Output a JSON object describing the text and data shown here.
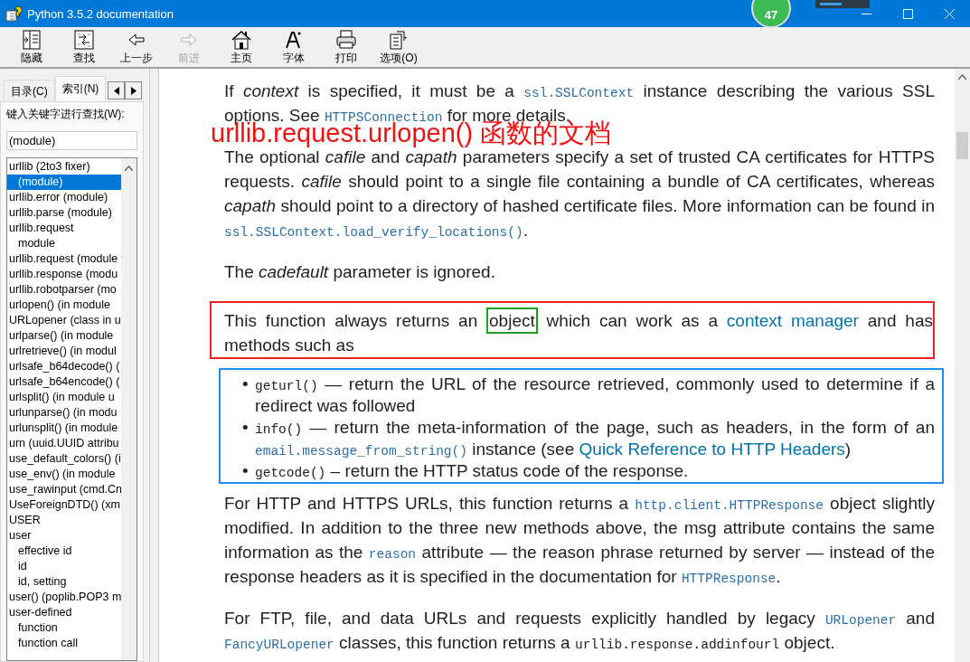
{
  "window": {
    "title": "Python 3.5.2 documentation"
  },
  "overlay": {
    "badge": "47"
  },
  "toolbar": [
    {
      "label": "隐藏",
      "disabled": false
    },
    {
      "label": "查找",
      "disabled": false
    },
    {
      "label": "上一步",
      "disabled": false
    },
    {
      "label": "前进",
      "disabled": true
    },
    {
      "label": "主页",
      "disabled": false
    },
    {
      "label": "字体",
      "disabled": false
    },
    {
      "label": "打印",
      "disabled": false
    },
    {
      "label": "选项(O)",
      "disabled": false
    }
  ],
  "sidebar": {
    "tabs": [
      {
        "label": "目录(C)",
        "selected": false
      },
      {
        "label": "索引(N)",
        "selected": true
      }
    ],
    "search_label": "键入关键字进行查找(W):",
    "search_value": "(module)",
    "items": [
      {
        "label": "urllib (2to3 fixer)",
        "selected": false,
        "children": [
          {
            "label": "(module)",
            "selected": true
          }
        ]
      },
      {
        "label": "urllib.error (module)",
        "selected": false
      },
      {
        "label": "urllib.parse (module)",
        "selected": false
      },
      {
        "label": "urllib.request",
        "selected": false,
        "children": [
          {
            "label": "module",
            "selected": false
          }
        ]
      },
      {
        "label": "urllib.request (module",
        "selected": false
      },
      {
        "label": "urllib.response (modu",
        "selected": false
      },
      {
        "label": "urllib.robotparser (mo",
        "selected": false
      },
      {
        "label": "urlopen() (in module",
        "selected": false
      },
      {
        "label": "URLopener (class in u",
        "selected": false
      },
      {
        "label": "urlparse() (in module",
        "selected": false
      },
      {
        "label": "urlretrieve() (in modul",
        "selected": false
      },
      {
        "label": "urlsafe_b64decode() (",
        "selected": false
      },
      {
        "label": "urlsafe_b64encode() (",
        "selected": false
      },
      {
        "label": "urlsplit() (in module u",
        "selected": false
      },
      {
        "label": "urlunparse() (in modu",
        "selected": false
      },
      {
        "label": "urlunsplit() (in module",
        "selected": false
      },
      {
        "label": "urn (uuid.UUID attribu",
        "selected": false
      },
      {
        "label": "use_default_colors() (i",
        "selected": false
      },
      {
        "label": "use_env() (in module",
        "selected": false
      },
      {
        "label": "use_rawinput (cmd.Cn",
        "selected": false
      },
      {
        "label": "UseForeignDTD() (xm",
        "selected": false
      },
      {
        "label": "USER",
        "selected": false
      },
      {
        "label": "user",
        "selected": false,
        "children": [
          {
            "label": "effective id",
            "selected": false
          },
          {
            "label": "id",
            "selected": false
          },
          {
            "label": "id, setting",
            "selected": false
          }
        ]
      },
      {
        "label": "user() (poplib.POP3 m",
        "selected": false
      },
      {
        "label": "user-defined",
        "selected": false,
        "children": [
          {
            "label": "function",
            "selected": false
          },
          {
            "label": "function call",
            "selected": false
          }
        ]
      }
    ]
  },
  "content": {
    "annotation": "urllib.request.urlopen() 函数的文档",
    "blocks": [
      {
        "kind": "paragraph",
        "parts": [
          {
            "kind": "text",
            "text": "If "
          },
          {
            "kind": "em",
            "text": "context"
          },
          {
            "kind": "text",
            "text": " is specified, it must be a "
          },
          {
            "kind": "xref",
            "text": "ssl.SSLContext"
          },
          {
            "kind": "text",
            "text": " instance describing the various SSL options. See "
          },
          {
            "kind": "xref",
            "text": "HTTPSConnection"
          },
          {
            "kind": "text",
            "text": " for more details."
          }
        ]
      },
      {
        "kind": "paragraph",
        "parts": [
          {
            "kind": "text",
            "text": "The optional "
          },
          {
            "kind": "em",
            "text": "cafile"
          },
          {
            "kind": "text",
            "text": " and "
          },
          {
            "kind": "em",
            "text": "capath"
          },
          {
            "kind": "text",
            "text": " parameters specify a set of trusted CA certificates for HTTPS requests. "
          },
          {
            "kind": "em",
            "text": "cafile"
          },
          {
            "kind": "text",
            "text": " should point to a single file containing a bundle of CA certificates, whereas "
          },
          {
            "kind": "em",
            "text": "capath"
          },
          {
            "kind": "text",
            "text": " should point to a directory of hashed certificate files. More information can be found in "
          },
          {
            "kind": "xref",
            "text": "ssl.SSLContext.load_verify_locations()"
          },
          {
            "kind": "text",
            "text": "."
          }
        ]
      },
      {
        "kind": "paragraph",
        "parts": [
          {
            "kind": "text",
            "text": "The "
          },
          {
            "kind": "em",
            "text": "cadefault"
          },
          {
            "kind": "text",
            "text": " parameter is ignored."
          }
        ]
      },
      {
        "kind": "framed_paragraph",
        "parts": [
          {
            "kind": "text",
            "text": "This function always returns an "
          },
          {
            "kind": "boxed",
            "text": "object"
          },
          {
            "kind": "text",
            "text": " which can work as a "
          },
          {
            "kind": "link",
            "text": "context manager"
          },
          {
            "kind": "text",
            "text": " and has methods such as"
          }
        ]
      },
      {
        "kind": "framed_list",
        "marker": "•",
        "items": [
          [
            {
              "kind": "code",
              "text": "geturl()"
            },
            {
              "kind": "text",
              "text": " — return the URL of the resource retrieved, commonly used to determine if a redirect was followed"
            }
          ],
          [
            {
              "kind": "code",
              "text": "info()"
            },
            {
              "kind": "text",
              "text": " — return the meta-information of the page, such as headers, in the form of an "
            },
            {
              "kind": "xref",
              "text": "email.message_from_string()"
            },
            {
              "kind": "text",
              "text": " instance (see "
            },
            {
              "kind": "link",
              "text": "Quick Reference to HTTP Headers"
            },
            {
              "kind": "text",
              "text": ")"
            }
          ],
          [
            {
              "kind": "code",
              "text": "getcode()"
            },
            {
              "kind": "text",
              "text": " – return the HTTP status code of the response."
            }
          ]
        ]
      },
      {
        "kind": "paragraph",
        "parts": [
          {
            "kind": "text",
            "text": "For HTTP and HTTPS URLs, this function returns a "
          },
          {
            "kind": "xref",
            "text": "http.client.HTTPResponse"
          },
          {
            "kind": "text",
            "text": " object slightly modified. In addition to the three new methods above, the msg attribute contains the same information as the "
          },
          {
            "kind": "xref",
            "text": "reason"
          },
          {
            "kind": "text",
            "text": " attribute — the reason phrase returned by server — instead of the response headers as it is specified in the documentation for "
          },
          {
            "kind": "xref",
            "text": "HTTPResponse"
          },
          {
            "kind": "text",
            "text": "."
          }
        ]
      },
      {
        "kind": "paragraph",
        "parts": [
          {
            "kind": "text",
            "text": "For FTP, file, and data URLs and requests explicitly handled by legacy "
          },
          {
            "kind": "xref",
            "text": "URLopener"
          },
          {
            "kind": "text",
            "text": " and "
          },
          {
            "kind": "xref",
            "text": "FancyURLopener"
          },
          {
            "kind": "text",
            "text": " classes, this function returns a "
          },
          {
            "kind": "code",
            "text": "urllib.response.addinfourl"
          },
          {
            "kind": "text",
            "text": " object."
          }
        ]
      }
    ]
  }
}
